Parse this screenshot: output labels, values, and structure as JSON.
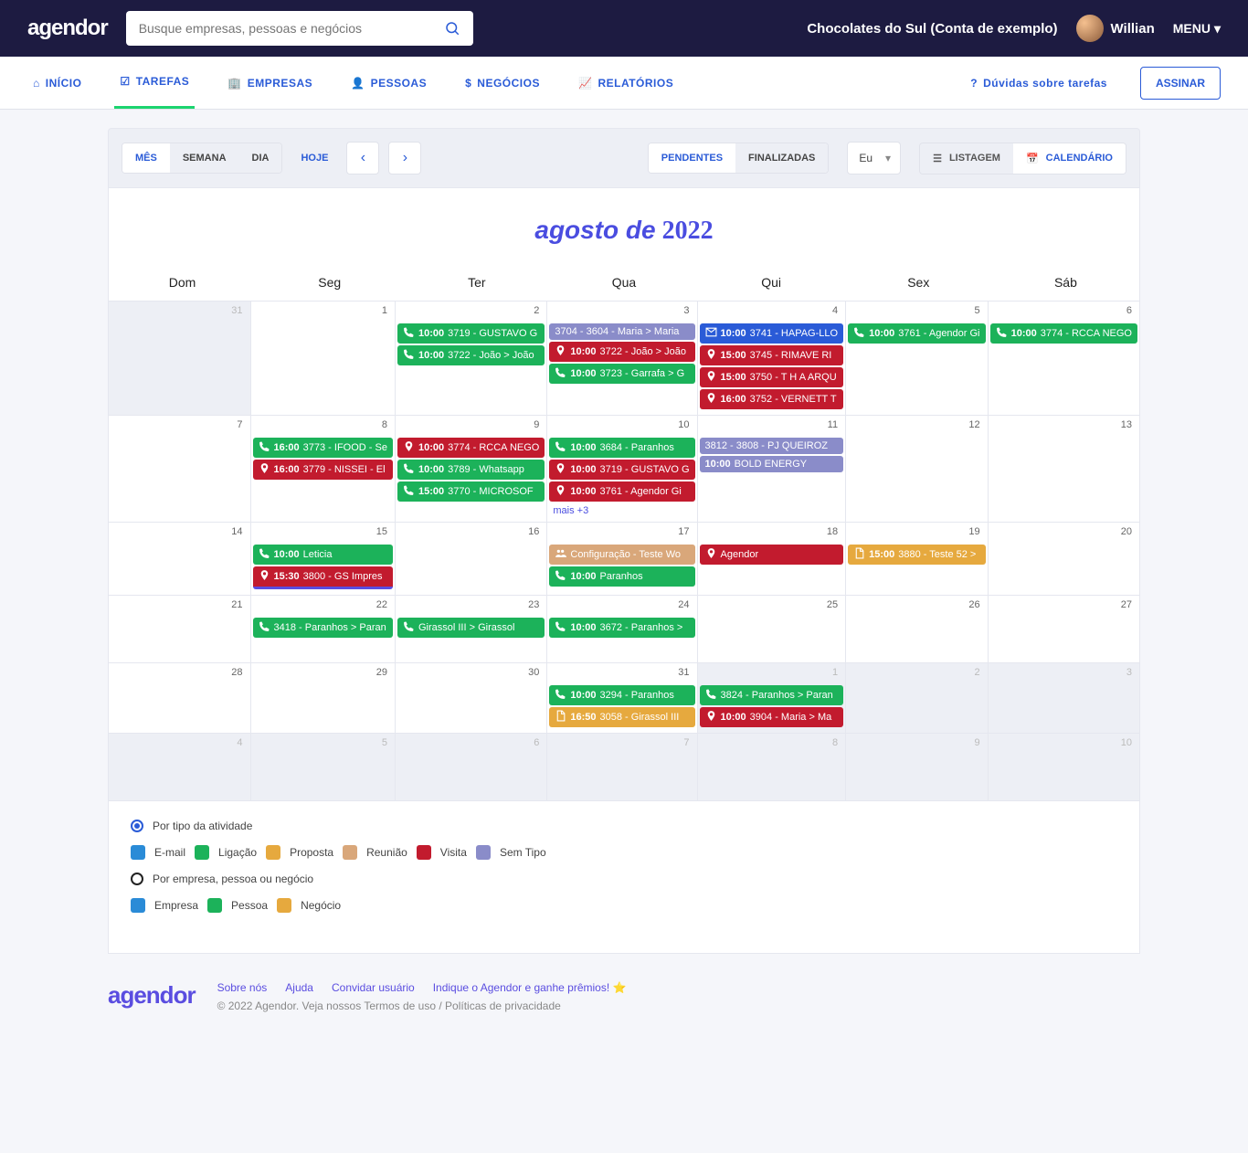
{
  "header": {
    "logo": "agendor",
    "search_placeholder": "Busque empresas, pessoas e negócios",
    "account": "Chocolates do Sul (Conta de exemplo)",
    "user": "Willian",
    "menu": "MENU"
  },
  "nav": {
    "inicio": "INÍCIO",
    "tarefas": "TAREFAS",
    "empresas": "EMPRESAS",
    "pessoas": "PESSOAS",
    "negocios": "NEGÓCIOS",
    "relatorios": "RELATÓRIOS",
    "help": "Dúvidas sobre tarefas",
    "assinar": "ASSINAR"
  },
  "toolbar": {
    "mes": "MÊS",
    "semana": "SEMANA",
    "dia": "DIA",
    "hoje": "HOJE",
    "pendentes": "PENDENTES",
    "finalizadas": "FINALIZADAS",
    "eu": "Eu",
    "listagem": "LISTAGEM",
    "calendario": "CALENDÁRIO"
  },
  "calendar": {
    "title_month": "agosto de",
    "title_year": "2022",
    "weekdays": [
      "Dom",
      "Seg",
      "Ter",
      "Qua",
      "Qui",
      "Sex",
      "Sáb"
    ],
    "more": "mais +3"
  },
  "cells": [
    {
      "n": "31",
      "in": false,
      "ev": []
    },
    {
      "n": "1",
      "in": true,
      "ev": []
    },
    {
      "n": "2",
      "in": true,
      "ev": [
        {
          "c": "ev-green",
          "i": "phone",
          "t": "10:00",
          "x": "3719 - GUSTAVO G"
        },
        {
          "c": "ev-green",
          "i": "phone",
          "t": "10:00",
          "x": "3722 - João > João"
        }
      ]
    },
    {
      "n": "3",
      "in": true,
      "ev": [
        {
          "c": "ev-purple",
          "i": "",
          "t": "",
          "x": "3704 - 3604 - Maria > Maria"
        },
        {
          "c": "ev-red",
          "i": "pin",
          "t": "10:00",
          "x": "3722 - João > João"
        },
        {
          "c": "ev-green",
          "i": "phone",
          "t": "10:00",
          "x": "3723 - Garrafa > G"
        }
      ]
    },
    {
      "n": "4",
      "in": true,
      "ev": [
        {
          "c": "ev-blue",
          "i": "mail",
          "t": "10:00",
          "x": "3741 - HAPAG-LLO"
        },
        {
          "c": "ev-red",
          "i": "pin",
          "t": "15:00",
          "x": "3745 - RIMAVE RI"
        },
        {
          "c": "ev-red",
          "i": "pin",
          "t": "15:00",
          "x": "3750 - T H A ARQU"
        },
        {
          "c": "ev-red",
          "i": "pin",
          "t": "16:00",
          "x": "3752 - VERNETT T"
        }
      ]
    },
    {
      "n": "5",
      "in": true,
      "ev": [
        {
          "c": "ev-green",
          "i": "phone",
          "t": "10:00",
          "x": "3761 - Agendor Gi"
        }
      ]
    },
    {
      "n": "6",
      "in": true,
      "ev": [
        {
          "c": "ev-green",
          "i": "phone",
          "t": "10:00",
          "x": "3774 - RCCA NEGO"
        }
      ]
    },
    {
      "n": "7",
      "in": true,
      "ev": []
    },
    {
      "n": "8",
      "in": true,
      "ev": [
        {
          "c": "ev-green",
          "i": "phone",
          "t": "16:00",
          "x": "3773 - IFOOD - Se"
        },
        {
          "c": "ev-red",
          "i": "pin",
          "t": "16:00",
          "x": "3779 - NISSEI - El"
        }
      ]
    },
    {
      "n": "9",
      "in": true,
      "ev": [
        {
          "c": "ev-red",
          "i": "pin",
          "t": "10:00",
          "x": "3774 - RCCA NEGO"
        },
        {
          "c": "ev-green",
          "i": "phone",
          "t": "10:00",
          "x": "3789 - Whatsapp"
        },
        {
          "c": "ev-green",
          "i": "phone",
          "t": "15:00",
          "x": "3770 - MICROSOF"
        }
      ]
    },
    {
      "n": "10",
      "in": true,
      "ev": [
        {
          "c": "ev-green",
          "i": "phone",
          "t": "10:00",
          "x": "3684 - Paranhos"
        },
        {
          "c": "ev-red",
          "i": "pin",
          "t": "10:00",
          "x": "3719 - GUSTAVO G"
        },
        {
          "c": "ev-red",
          "i": "pin",
          "t": "10:00",
          "x": "3761 - Agendor Gi"
        }
      ],
      "more": true
    },
    {
      "n": "11",
      "in": true,
      "ev": [
        {
          "c": "ev-purple",
          "i": "",
          "t": "",
          "x": "3812 - 3808 - PJ QUEIROZ"
        },
        {
          "c": "ev-purple",
          "i": "",
          "t": "10:00",
          "x": "BOLD ENERGY"
        }
      ]
    },
    {
      "n": "12",
      "in": true,
      "ev": []
    },
    {
      "n": "13",
      "in": true,
      "ev": []
    },
    {
      "n": "14",
      "in": true,
      "ev": []
    },
    {
      "n": "15",
      "in": true,
      "ev": [
        {
          "c": "ev-green",
          "i": "phone",
          "t": "10:00",
          "x": "Leticia"
        },
        {
          "c": "ev-red-border",
          "i": "pin",
          "t": "15:30",
          "x": "3800 - GS Impres"
        }
      ]
    },
    {
      "n": "16",
      "in": true,
      "ev": []
    },
    {
      "n": "17",
      "in": true,
      "ev": [
        {
          "c": "ev-peach",
          "i": "people",
          "t": "",
          "x": "Configuração - Teste Wo"
        },
        {
          "c": "ev-green",
          "i": "phone",
          "t": "10:00",
          "x": "Paranhos"
        }
      ]
    },
    {
      "n": "18",
      "in": true,
      "ev": [
        {
          "c": "ev-red",
          "i": "pin",
          "t": "",
          "x": "Agendor"
        }
      ]
    },
    {
      "n": "19",
      "in": true,
      "ev": [
        {
          "c": "ev-orange",
          "i": "doc",
          "t": "15:00",
          "x": "3880 - Teste 52 >"
        }
      ]
    },
    {
      "n": "20",
      "in": true,
      "ev": []
    },
    {
      "n": "21",
      "in": true,
      "ev": []
    },
    {
      "n": "22",
      "in": true,
      "ev": [
        {
          "c": "ev-green",
          "i": "phone",
          "t": "",
          "x": "3418 - Paranhos > Paran"
        }
      ]
    },
    {
      "n": "23",
      "in": true,
      "ev": [
        {
          "c": "ev-green",
          "i": "phone",
          "t": "",
          "x": "Girassol III > Girassol"
        }
      ]
    },
    {
      "n": "24",
      "in": true,
      "ev": [
        {
          "c": "ev-green",
          "i": "phone",
          "t": "10:00",
          "x": "3672 - Paranhos >"
        }
      ]
    },
    {
      "n": "25",
      "in": true,
      "ev": []
    },
    {
      "n": "26",
      "in": true,
      "ev": []
    },
    {
      "n": "27",
      "in": true,
      "ev": []
    },
    {
      "n": "28",
      "in": true,
      "ev": []
    },
    {
      "n": "29",
      "in": true,
      "ev": []
    },
    {
      "n": "30",
      "in": true,
      "ev": []
    },
    {
      "n": "31",
      "in": true,
      "ev": [
        {
          "c": "ev-green",
          "i": "phone",
          "t": "10:00",
          "x": "3294 - Paranhos"
        },
        {
          "c": "ev-orange",
          "i": "doc",
          "t": "16:50",
          "x": "3058 - Girassol III"
        }
      ]
    },
    {
      "n": "1",
      "in": false,
      "ev": [
        {
          "c": "ev-green",
          "i": "phone",
          "t": "",
          "x": "3824 - Paranhos > Paran"
        },
        {
          "c": "ev-red",
          "i": "pin",
          "t": "10:00",
          "x": "3904 - Maria > Ma"
        }
      ]
    },
    {
      "n": "2",
      "in": false,
      "ev": []
    },
    {
      "n": "3",
      "in": false,
      "ev": []
    },
    {
      "n": "4",
      "in": false,
      "ev": []
    },
    {
      "n": "5",
      "in": false,
      "ev": []
    },
    {
      "n": "6",
      "in": false,
      "ev": []
    },
    {
      "n": "7",
      "in": false,
      "ev": []
    },
    {
      "n": "8",
      "in": false,
      "ev": []
    },
    {
      "n": "9",
      "in": false,
      "ev": []
    },
    {
      "n": "10",
      "in": false,
      "ev": []
    }
  ],
  "legend": {
    "by_type": "Por tipo da atividade",
    "email": "E-mail",
    "ligacao": "Ligação",
    "proposta": "Proposta",
    "reuniao": "Reunião",
    "visita": "Visita",
    "semtipo": "Sem Tipo",
    "by_entity": "Por empresa, pessoa ou negócio",
    "empresa": "Empresa",
    "pessoa": "Pessoa",
    "negocio": "Negócio"
  },
  "footer": {
    "logo": "agendor",
    "sobre": "Sobre nós",
    "ajuda": "Ajuda",
    "convidar": "Convidar usuário",
    "indique": "Indique o Agendor e ganhe prêmios!",
    "copy": "© 2022 Agendor. Veja nossos ",
    "termos": "Termos de uso",
    "sep": " / ",
    "priv": "Políticas de privacidade"
  }
}
